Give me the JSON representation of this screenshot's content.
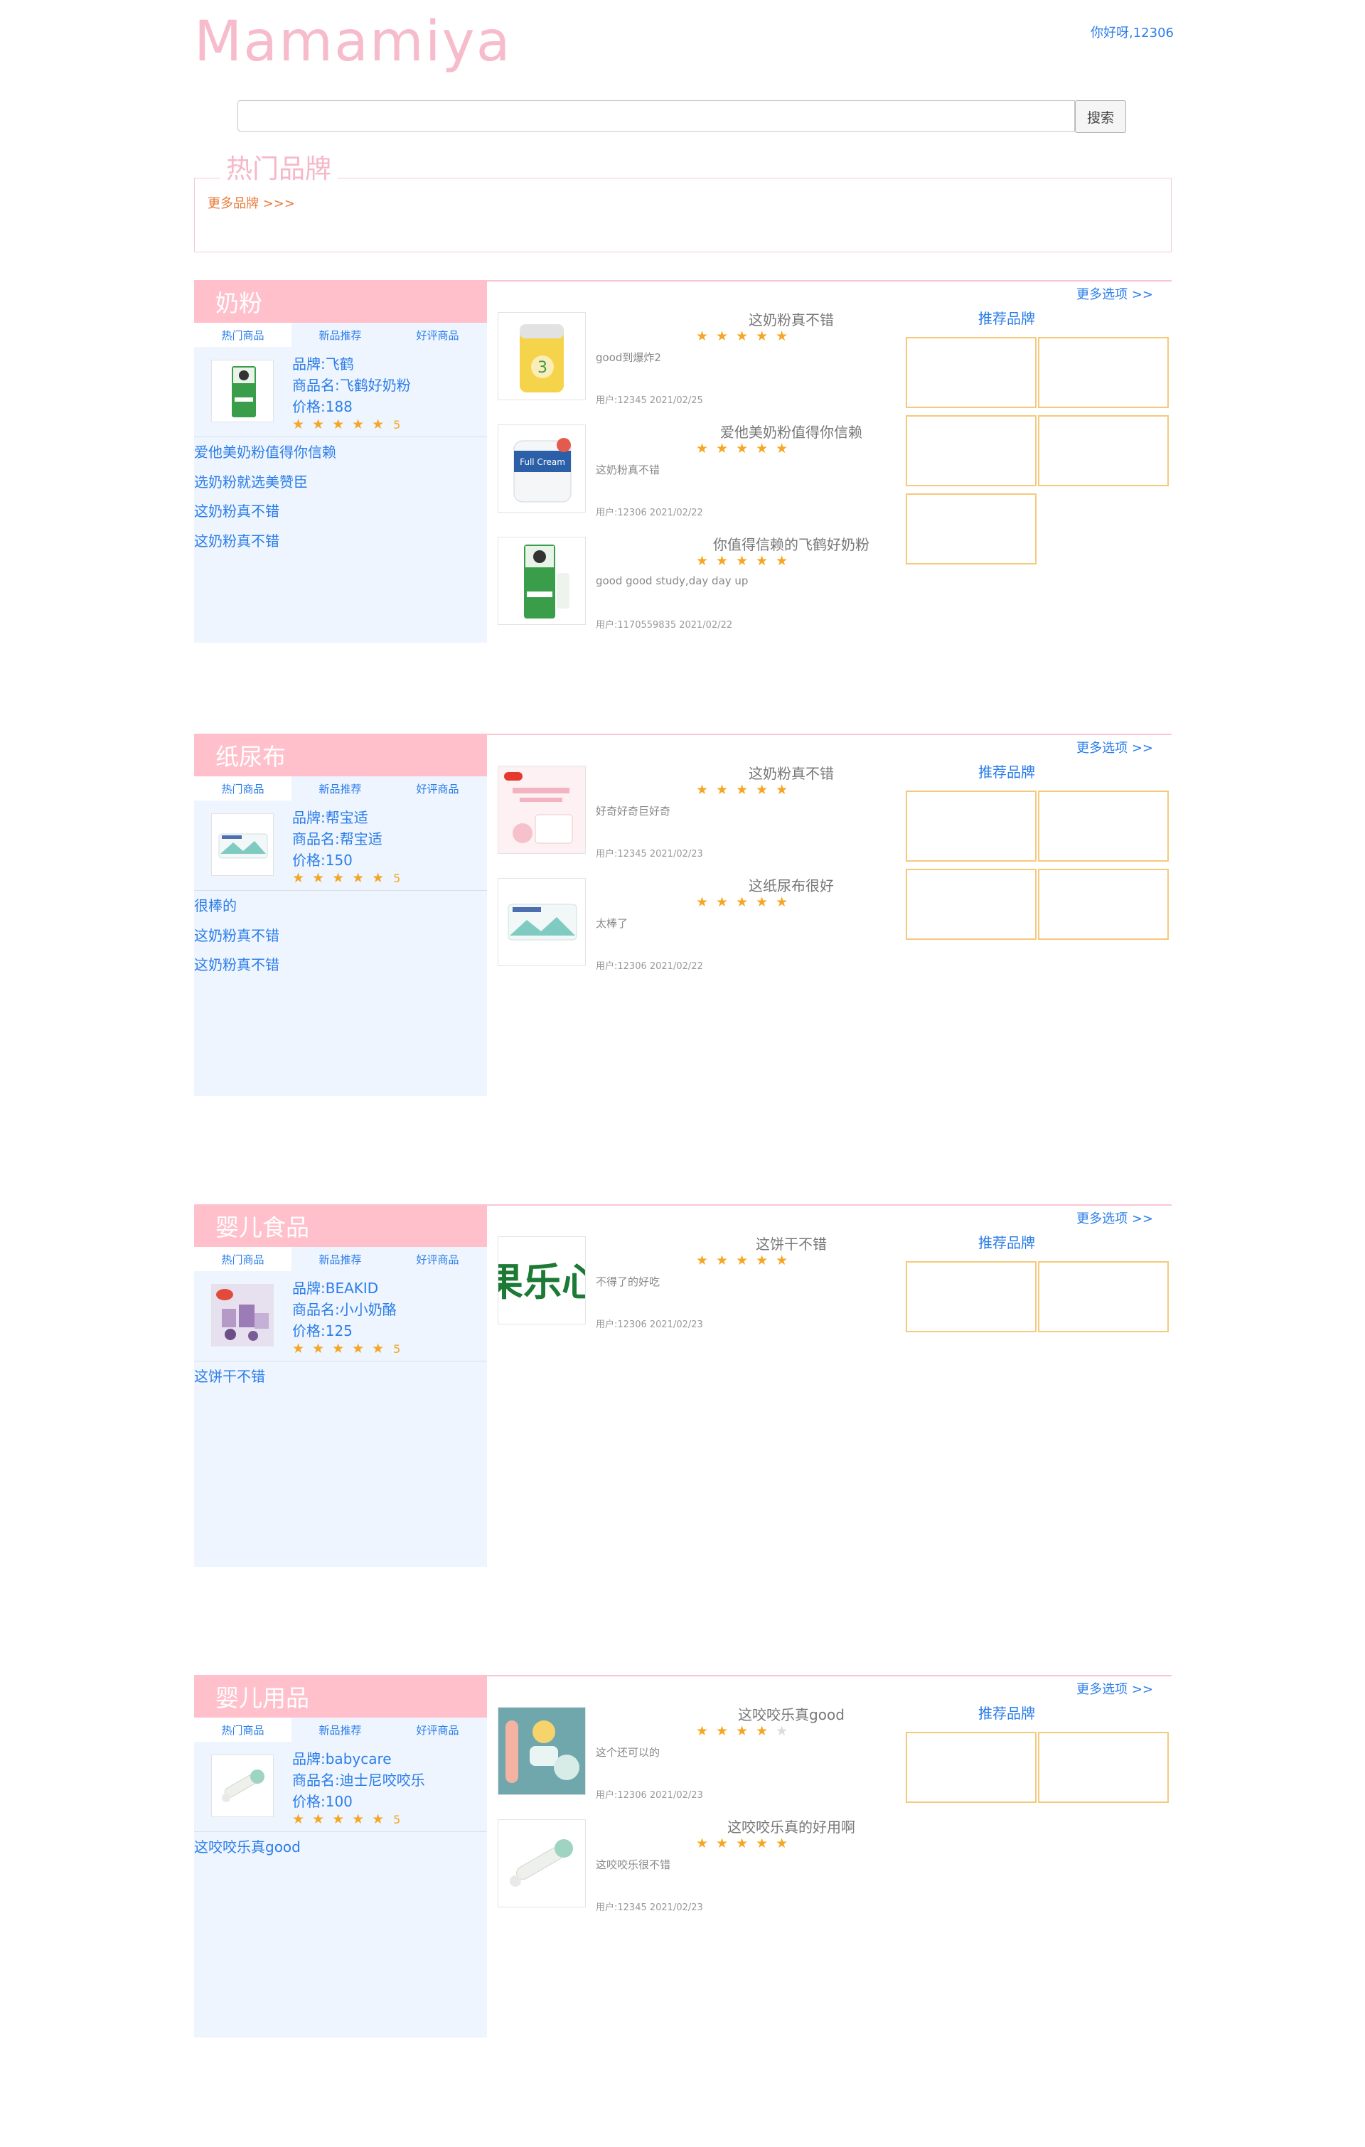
{
  "header": {
    "logo": "Mamamiya",
    "greeting": "你好呀,12306",
    "search_placeholder": "",
    "search_button": "搜索"
  },
  "hot_brands": {
    "title": "热门品牌",
    "more": "更多品牌 >>>"
  },
  "common": {
    "more_options": "更多选项 >>",
    "recommended_brands": "推荐品牌",
    "tabs": [
      "热门商品",
      "新品推荐",
      "好评商品"
    ]
  },
  "sections": [
    {
      "title": "奶粉",
      "featured": {
        "brand": "品牌:飞鹤",
        "name": "商品名:飞鹤好奶粉",
        "price": "价格:188",
        "rating": "5"
      },
      "links": [
        "爱他美奶粉值得你信赖",
        "选奶粉就选美赞臣",
        "这奶粉真不错",
        "这奶粉真不错"
      ],
      "reviews": [
        {
          "title": "这奶粉真不错",
          "stars": 5,
          "text": "good到爆炸2",
          "user": "用户:12345 2021/02/25"
        },
        {
          "title": "爱他美奶粉值得你信赖",
          "stars": 5,
          "text": "这奶粉真不错",
          "user": "用户:12306 2021/02/22"
        },
        {
          "title": "你值得信赖的飞鹤好奶粉",
          "stars": 5,
          "text": "good good study,day day up",
          "user": "用户:1170559835 2021/02/22"
        }
      ],
      "brand_boxes": 5
    },
    {
      "title": "纸尿布",
      "featured": {
        "brand": "品牌:帮宝适",
        "name": "商品名:帮宝适",
        "price": "价格:150",
        "rating": "5"
      },
      "links": [
        "很棒的",
        "这奶粉真不错",
        "这奶粉真不错"
      ],
      "reviews": [
        {
          "title": "这奶粉真不错",
          "stars": 5,
          "text": "好奇好奇巨好奇",
          "user": "用户:12345 2021/02/23"
        },
        {
          "title": "这纸尿布很好",
          "stars": 5,
          "text": "太棒了",
          "user": "用户:12306 2021/02/22"
        }
      ],
      "brand_boxes": 4
    },
    {
      "title": "婴儿食品",
      "featured": {
        "brand": "品牌:BEAKID",
        "name": "商品名:小小奶酪",
        "price": "价格:125",
        "rating": "5"
      },
      "links": [
        "这饼干不错"
      ],
      "reviews": [
        {
          "title": "这饼干不错",
          "stars": 5,
          "text": "不得了的好吃",
          "user": "用户:12306 2021/02/23",
          "logo_text": "果乐心"
        }
      ],
      "brand_boxes": 2
    },
    {
      "title": "婴儿用品",
      "featured": {
        "brand": "品牌:babycare",
        "name": "商品名:迪士尼咬咬乐",
        "price": "价格:100",
        "rating": "5"
      },
      "links": [
        "这咬咬乐真good"
      ],
      "reviews": [
        {
          "title": "这咬咬乐真good",
          "stars": 4,
          "text": "这个还可以的",
          "user": "用户:12306 2021/02/23"
        },
        {
          "title": "这咬咬乐真的好用啊",
          "stars": 5,
          "text": "这咬咬乐很不错",
          "user": "用户:12345 2021/02/23"
        }
      ],
      "brand_boxes": 2
    }
  ]
}
